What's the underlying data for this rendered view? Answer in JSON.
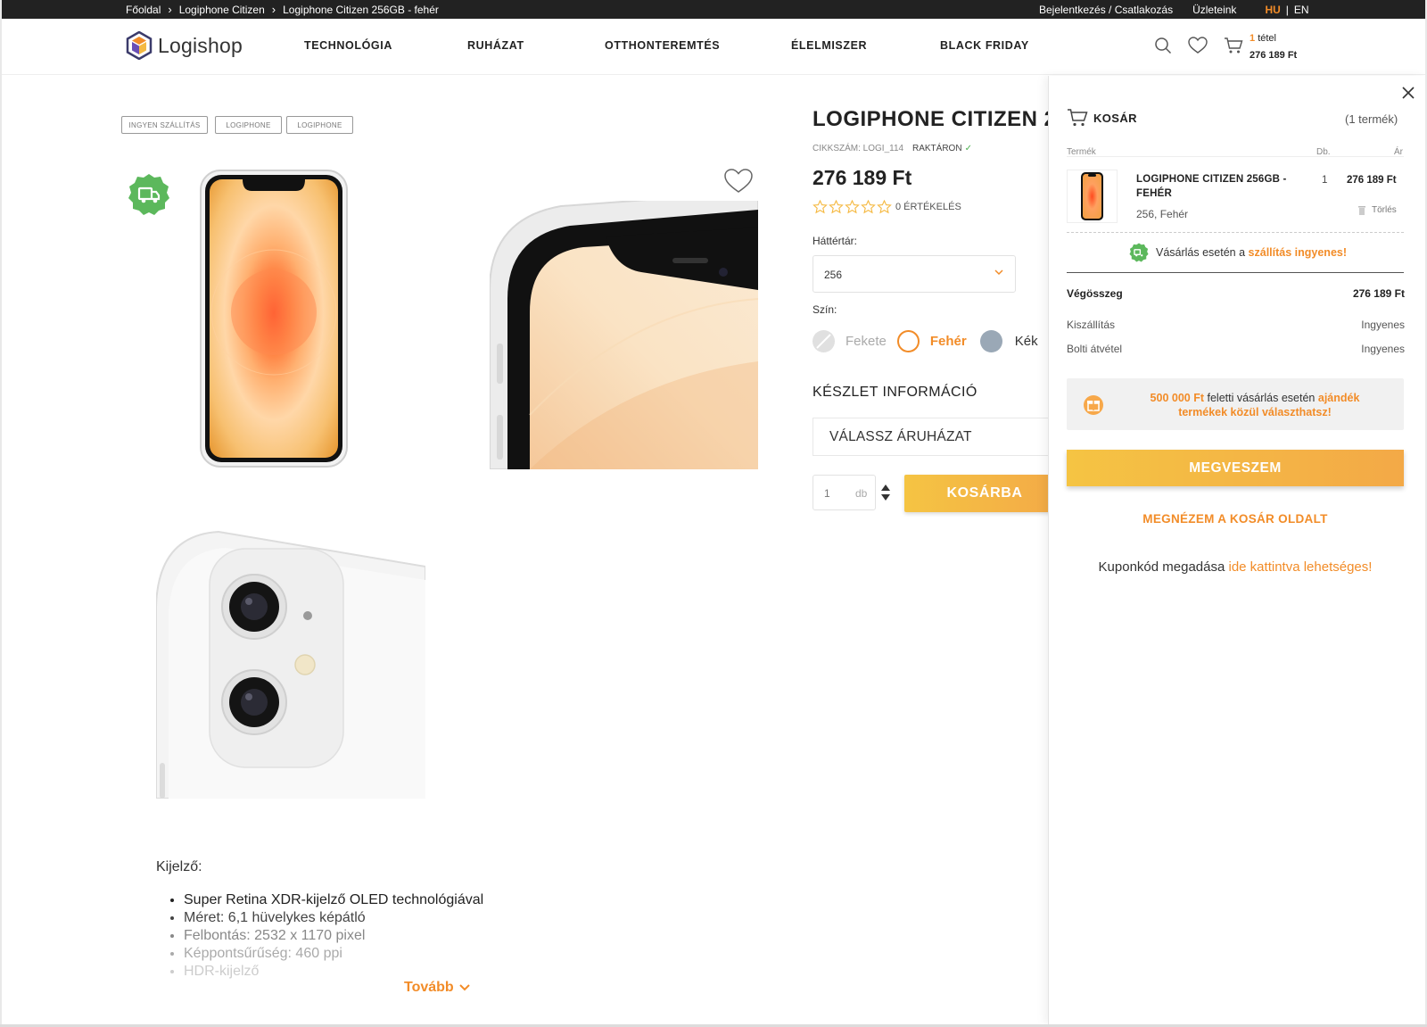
{
  "topbar": {
    "breadcrumbs": [
      "Főoldal",
      "Logiphone Citizen",
      "Logiphone Citizen 256GB - fehér"
    ],
    "login": "Bejelentkezés / Csatlakozás",
    "stores": "Üzleteink",
    "lang_hu": "HU",
    "lang_sep": "|",
    "lang_en": "EN"
  },
  "header": {
    "logo": "Logishop",
    "nav": [
      "TECHNOLÓGIA",
      "RUHÁZAT",
      "OTTHONTEREMTÉS",
      "ÉLELMISZER",
      "BLACK FRIDAY"
    ],
    "cart_count": "1",
    "cart_count_label": "tétel",
    "cart_total": "276 189 Ft"
  },
  "product": {
    "tags": [
      "INGYEN SZÁLLÍTÁS",
      "LOGIPHONE",
      "LOGIPHONE"
    ],
    "title": "LOGIPHONE CITIZEN 2",
    "sku": "CIKKSZÁM: LOGI_114",
    "stock": "RAKTÁRON",
    "price": "276 189 Ft",
    "rating": 0,
    "rating_max": 5,
    "reviews": "0 ÉRTÉKELÉS",
    "storage_label": "Háttértár:",
    "storage_value": "256",
    "color_label": "Szín:",
    "colors": [
      {
        "name": "Fekete",
        "color": "#e0e0e0",
        "state": "unavailable"
      },
      {
        "name": "Fehér",
        "color": "#ffffff",
        "state": "selected"
      },
      {
        "name": "Kék",
        "color": "#9aa8b6",
        "state": "available"
      }
    ],
    "stock_info_label": "KÉSZLET INFORMÁCIÓ",
    "store_select": "VÁLASSZ ÁRUHÁZAT",
    "qty": "1",
    "qty_unit": "db",
    "add_to_cart": "KOSÁRBA"
  },
  "description": {
    "title": "Kijelző:",
    "items": [
      "Super Retina XDR-kijelző OLED technológiával",
      "Méret: 6,1 hüvelykes képátló",
      "Felbontás: 2532 x 1170 pixel",
      "Képpontsűrűség: 460 ppi",
      "HDR-kijelző"
    ],
    "more": "Tovább"
  },
  "cart": {
    "title": "KOSÁR",
    "count": "(1 termék)",
    "col_product": "Termék",
    "col_qty": "Db.",
    "col_price": "Ár",
    "item": {
      "name": "LOGIPHONE CITIZEN 256GB - FEHÉR",
      "variant": "256,  Fehér",
      "qty": "1",
      "price": "276 189 Ft",
      "delete": "Törlés"
    },
    "free_shipping_pre": "Vásárlás esetén a ",
    "free_shipping_hl": "szállítás ingyenes!",
    "total_label": "Végösszeg",
    "total_value": "276 189 Ft",
    "shipping_label": "Kiszállítás",
    "shipping_value": "Ingyenes",
    "pickup_label": "Bolti átvétel",
    "pickup_value": "Ingyenes",
    "gift_amount": "500 000 Ft",
    "gift_mid": " feletti vásárlás esetén ",
    "gift_hl": "ajándék termékek közül választhatsz!",
    "buy_button": "MEGVESZEM",
    "view_cart": "MEGNÉZEM A KOSÁR OLDALT",
    "coupon_pre": "Kuponkód megadása ",
    "coupon_link": "ide kattintva lehetséges!"
  },
  "colors": {
    "accent": "#f28c28",
    "green": "#4caf50",
    "dark": "#222222"
  }
}
